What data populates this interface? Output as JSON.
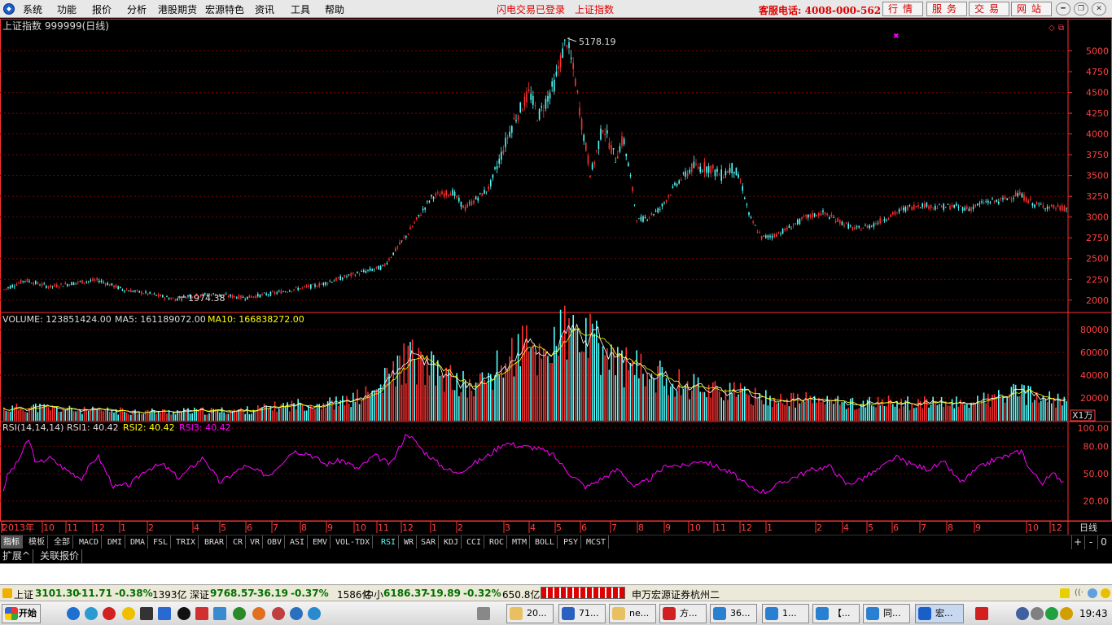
{
  "menubar": {
    "items": [
      "系统",
      "功能",
      "报价",
      "分析",
      "港股期货",
      "宏源特色",
      "资讯",
      "工具",
      "帮助"
    ],
    "login_status": "闪电交易已登录",
    "current_index": "上证指数",
    "hotline": "客服电话: 4008-000-562",
    "buttons": [
      "行情",
      "服务",
      "交易",
      "网站"
    ]
  },
  "chart": {
    "title": "上证指数 999999(日线)",
    "price_max_label": "5178.19",
    "price_min_label": "1974.38",
    "volume_legend": {
      "vol": "VOLUME: 123851424.00",
      "ma5": "MA5: 161189072.00",
      "ma10": "MA10: 166838272.00"
    },
    "vol_unit": "X1万",
    "rsi_legend": {
      "label": "RSI(14,14,14)",
      "rsi1": "RSI1: 40.42",
      "rsi2": "RSI2: 40.42",
      "rsi3": "RSI3: 40.42"
    },
    "period_label": "日线",
    "colors": {
      "up": "#ff3030",
      "down": "#54ffff",
      "ma5": "#ffffff",
      "ma10": "#ffff00",
      "rsi": "#ff00ff",
      "grid": "#7a0000",
      "axis": "#ff3030"
    }
  },
  "chart_data": {
    "type": "candlestick",
    "price_axis": {
      "ticks": [
        2000,
        2250,
        2500,
        2750,
        3000,
        3250,
        3500,
        3750,
        4000,
        4250,
        4500,
        4750,
        5000
      ],
      "ylim": [
        1900,
        5250
      ]
    },
    "volume_axis": {
      "ticks": [
        20000,
        40000,
        60000,
        80000
      ],
      "ylim": [
        0,
        85000
      ]
    },
    "rsi_axis": {
      "ticks": [
        "20.00",
        "50.00",
        "80.00",
        "100.00"
      ],
      "ylim": [
        0,
        100
      ]
    },
    "x_labels": [
      "2013年",
      "10",
      "11",
      "12",
      "1",
      "2",
      "4",
      "5",
      "6",
      "7",
      "8",
      "9",
      "10",
      "11",
      "12",
      "1",
      "2",
      "3",
      "4",
      "5",
      "6",
      "7",
      "8",
      "9",
      "10",
      "11",
      "12",
      "1",
      "2",
      "4",
      "5",
      "6",
      "7",
      "8",
      "9",
      "10",
      "12",
      "1"
    ],
    "close_profile": [
      [
        0,
        2110
      ],
      [
        30,
        2240
      ],
      [
        60,
        2160
      ],
      [
        100,
        2220
      ],
      [
        120,
        2240
      ],
      [
        150,
        2130
      ],
      [
        180,
        2080
      ],
      [
        215,
        2010
      ],
      [
        230,
        2050
      ],
      [
        260,
        2070
      ],
      [
        300,
        2030
      ],
      [
        340,
        2090
      ],
      [
        360,
        2130
      ],
      [
        390,
        2180
      ],
      [
        430,
        2300
      ],
      [
        470,
        2400
      ],
      [
        500,
        2800
      ],
      [
        530,
        3250
      ],
      [
        555,
        3300
      ],
      [
        570,
        3100
      ],
      [
        600,
        3350
      ],
      [
        630,
        4150
      ],
      [
        650,
        4500
      ],
      [
        660,
        4200
      ],
      [
        680,
        4600
      ],
      [
        695,
        5150
      ],
      [
        705,
        4700
      ],
      [
        715,
        4050
      ],
      [
        725,
        3500
      ],
      [
        740,
        4100
      ],
      [
        755,
        3700
      ],
      [
        765,
        3950
      ],
      [
        775,
        3400
      ],
      [
        782,
        2950
      ],
      [
        795,
        3000
      ],
      [
        810,
        3100
      ],
      [
        830,
        3400
      ],
      [
        850,
        3600
      ],
      [
        870,
        3600
      ],
      [
        885,
        3500
      ],
      [
        900,
        3600
      ],
      [
        910,
        3400
      ],
      [
        920,
        3000
      ],
      [
        935,
        2750
      ],
      [
        950,
        2780
      ],
      [
        965,
        2850
      ],
      [
        990,
        3000
      ],
      [
        1010,
        3050
      ],
      [
        1030,
        2950
      ],
      [
        1050,
        2850
      ],
      [
        1070,
        2900
      ],
      [
        1090,
        3000
      ],
      [
        1110,
        3100
      ],
      [
        1130,
        3150
      ],
      [
        1150,
        3120
      ],
      [
        1170,
        3130
      ],
      [
        1190,
        3100
      ],
      [
        1210,
        3180
      ],
      [
        1230,
        3200
      ],
      [
        1250,
        3280
      ],
      [
        1270,
        3150
      ],
      [
        1290,
        3120
      ],
      [
        1308,
        3101
      ]
    ],
    "volume_profile": [
      [
        0,
        10000
      ],
      [
        40,
        12000
      ],
      [
        100,
        9000
      ],
      [
        200,
        8000
      ],
      [
        300,
        9000
      ],
      [
        360,
        14000
      ],
      [
        420,
        16000
      ],
      [
        460,
        25000
      ],
      [
        500,
        55000
      ],
      [
        540,
        40000
      ],
      [
        580,
        28000
      ],
      [
        620,
        50000
      ],
      [
        640,
        65000
      ],
      [
        660,
        55000
      ],
      [
        690,
        75000
      ],
      [
        720,
        70000
      ],
      [
        760,
        50000
      ],
      [
        800,
        40000
      ],
      [
        840,
        32000
      ],
      [
        880,
        28000
      ],
      [
        920,
        22000
      ],
      [
        960,
        18000
      ],
      [
        1000,
        18000
      ],
      [
        1050,
        15000
      ],
      [
        1100,
        16000
      ],
      [
        1150,
        15000
      ],
      [
        1200,
        17000
      ],
      [
        1250,
        24000
      ],
      [
        1308,
        16000
      ]
    ],
    "rsi_profile": [
      [
        0,
        20
      ],
      [
        10,
        50
      ],
      [
        20,
        60
      ],
      [
        35,
        88
      ],
      [
        45,
        60
      ],
      [
        60,
        68
      ],
      [
        80,
        55
      ],
      [
        100,
        45
      ],
      [
        120,
        70
      ],
      [
        140,
        35
      ],
      [
        160,
        38
      ],
      [
        180,
        55
      ],
      [
        200,
        60
      ],
      [
        220,
        45
      ],
      [
        250,
        68
      ],
      [
        270,
        40
      ],
      [
        300,
        58
      ],
      [
        330,
        48
      ],
      [
        360,
        75
      ],
      [
        380,
        72
      ],
      [
        400,
        60
      ],
      [
        420,
        65
      ],
      [
        440,
        55
      ],
      [
        460,
        70
      ],
      [
        480,
        60
      ],
      [
        500,
        95
      ],
      [
        520,
        75
      ],
      [
        540,
        60
      ],
      [
        560,
        50
      ],
      [
        580,
        60
      ],
      [
        600,
        70
      ],
      [
        620,
        84
      ],
      [
        640,
        80
      ],
      [
        660,
        78
      ],
      [
        680,
        70
      ],
      [
        700,
        50
      ],
      [
        720,
        35
      ],
      [
        740,
        45
      ],
      [
        760,
        55
      ],
      [
        780,
        35
      ],
      [
        800,
        45
      ],
      [
        820,
        60
      ],
      [
        840,
        58
      ],
      [
        860,
        65
      ],
      [
        880,
        58
      ],
      [
        900,
        50
      ],
      [
        920,
        35
      ],
      [
        940,
        30
      ],
      [
        960,
        40
      ],
      [
        980,
        48
      ],
      [
        1000,
        55
      ],
      [
        1020,
        58
      ],
      [
        1040,
        38
      ],
      [
        1060,
        45
      ],
      [
        1080,
        55
      ],
      [
        1100,
        68
      ],
      [
        1120,
        60
      ],
      [
        1140,
        55
      ],
      [
        1160,
        62
      ],
      [
        1180,
        40
      ],
      [
        1200,
        55
      ],
      [
        1220,
        65
      ],
      [
        1240,
        70
      ],
      [
        1255,
        75
      ],
      [
        1265,
        55
      ],
      [
        1280,
        40
      ],
      [
        1295,
        50
      ],
      [
        1308,
        40
      ]
    ]
  },
  "indicator_tabs": [
    "指标",
    "模板",
    "全部",
    "MACD",
    "DMI",
    "DMA",
    "FSL",
    "TRIX",
    "BRAR",
    "CR",
    "VR",
    "OBV",
    "ASI",
    "EMV",
    "VOL-TDX",
    "RSI",
    "WR",
    "SAR",
    "KDJ",
    "CCI",
    "ROC",
    "MTM",
    "BOLL",
    "PSY",
    "MCST"
  ],
  "active_tab": "RSI",
  "tab_controls": [
    "+",
    "-",
    "0"
  ],
  "sub_tabs": [
    "扩展^",
    "关联报价"
  ],
  "statusbar": {
    "sh_label": "上证",
    "sh_price": "3101.30",
    "sh_chg": "-11.71",
    "sh_pct": "-0.38%",
    "sh_amt": "1393亿",
    "sz_label": "深证",
    "sz_price": "9768.57",
    "sz_chg": "-36.19",
    "sz_pct": "-0.37%",
    "sz_amt": "1586亿",
    "zx_label": "中小",
    "zx_price": "6186.37",
    "zx_chg": "-19.89",
    "zx_pct": "-0.32%",
    "zx_amt": "650.8亿",
    "broker": "申万宏源证券杭州二"
  },
  "taskbar": {
    "start": "开始",
    "tasks": [
      "20...",
      "71...",
      "ne...",
      "方...",
      "36...",
      "1...",
      "【...",
      "同...",
      "宏..."
    ],
    "time": "19:43"
  }
}
